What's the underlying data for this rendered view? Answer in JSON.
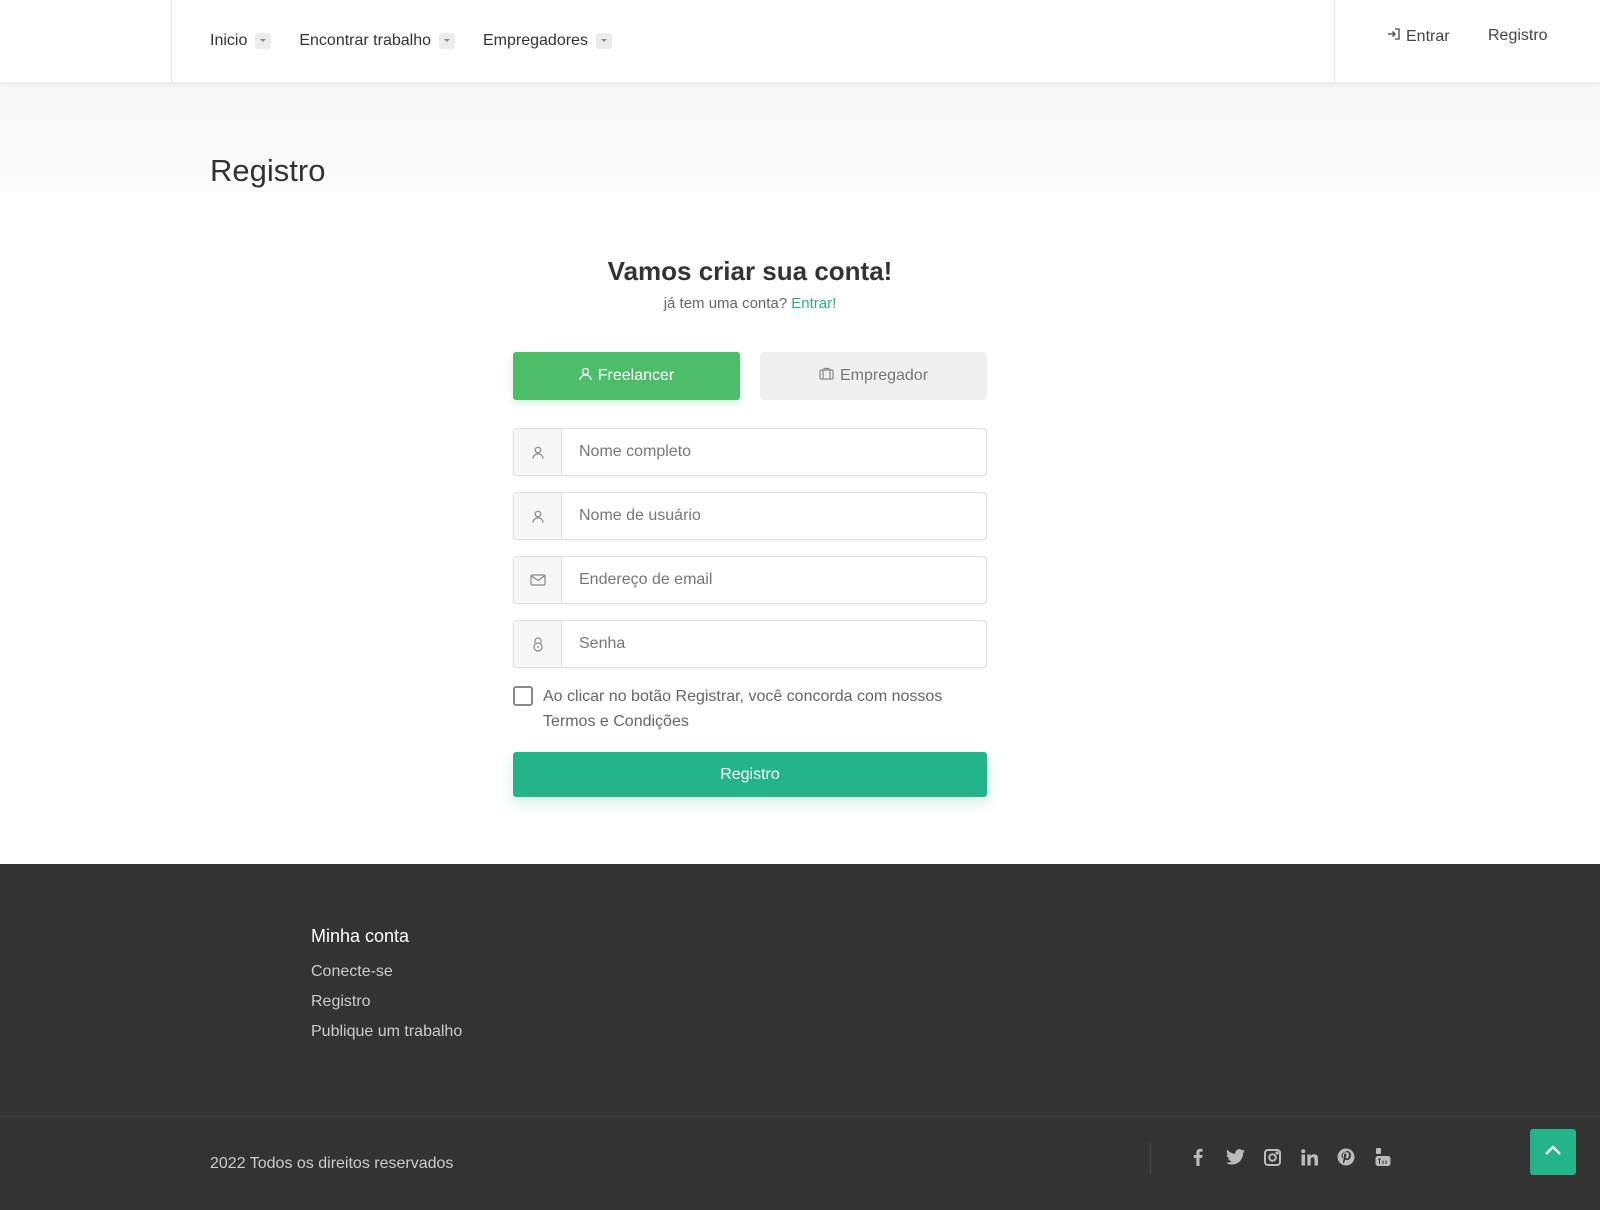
{
  "header": {
    "nav": [
      {
        "label": "Inicio"
      },
      {
        "label": "Encontrar trabalho"
      },
      {
        "label": "Empregadores"
      }
    ],
    "login_label": "Entrar",
    "register_label": "Registro"
  },
  "page": {
    "title": "Registro"
  },
  "form": {
    "heading": "Vamos criar sua conta!",
    "subtitle_prefix": "já tem uma conta?",
    "subtitle_link": "Entrar!",
    "tabs": [
      {
        "label": "Freelancer",
        "icon": "user-icon",
        "active": true
      },
      {
        "label": "Empregador",
        "icon": "briefcase-icon",
        "active": false
      }
    ],
    "fields": {
      "fullname_placeholder": "Nome completo",
      "username_placeholder": "Nome de usuário",
      "email_placeholder": "Endereço de email",
      "password_placeholder": "Senha"
    },
    "terms_text": "Ao clicar no botão Registrar, você concorda com nossos Termos e Condições",
    "submit_label": "Registro"
  },
  "footer": {
    "heading": "Minha conta",
    "links": [
      "Conecte-se",
      "Registro",
      "Publique um trabalho"
    ],
    "copyright": "2022 Todos os direitos reservados",
    "socials": [
      "facebook-icon",
      "twitter-icon",
      "instagram-icon",
      "linkedin-icon",
      "pinterest-icon",
      "youtube-icon"
    ]
  },
  "colors": {
    "accent_green": "#4cbd68",
    "button_teal": "#23b489",
    "footer_bg": "#333333",
    "link_green": "#2ab27b"
  }
}
